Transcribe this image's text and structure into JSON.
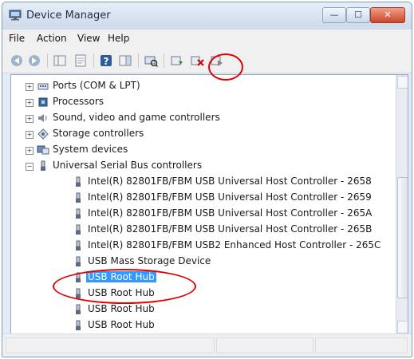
{
  "window": {
    "title": "Device Manager"
  },
  "menubar": {
    "items": [
      "File",
      "Action",
      "View",
      "Help"
    ]
  },
  "toolbar": {
    "buttons": [
      "back-arrow-icon",
      "forward-arrow-icon",
      "show-hide-console-tree-icon",
      "properties-icon",
      "help-icon",
      "action-pane-icon",
      "scan-hardware-icon",
      "update-driver-icon",
      "uninstall-device-icon",
      "disable-device-icon"
    ]
  },
  "tree": {
    "categories": [
      {
        "label": "Ports (COM & LPT)",
        "icon": "port-icon",
        "expanded": false
      },
      {
        "label": "Processors",
        "icon": "processor-icon",
        "expanded": false
      },
      {
        "label": "Sound, video and game controllers",
        "icon": "sound-icon",
        "expanded": false
      },
      {
        "label": "Storage controllers",
        "icon": "storage-controller-icon",
        "expanded": false
      },
      {
        "label": "System devices",
        "icon": "system-devices-icon",
        "expanded": false
      },
      {
        "label": "Universal Serial Bus controllers",
        "icon": "usb-icon",
        "expanded": true
      }
    ],
    "usb_children": [
      "Intel(R) 82801FB/FBM USB Universal Host Controller - 2658",
      "Intel(R) 82801FB/FBM USB Universal Host Controller - 2659",
      "Intel(R) 82801FB/FBM USB Universal Host Controller - 265A",
      "Intel(R) 82801FB/FBM USB Universal Host Controller - 265B",
      "Intel(R) 82801FB/FBM USB2 Enhanced Host Controller - 265C",
      "USB Mass Storage Device",
      "USB Root Hub",
      "USB Root Hub",
      "USB Root Hub",
      "USB Root Hub"
    ],
    "selected": "USB Root Hub"
  },
  "annotation": {
    "color": "#e10000"
  }
}
